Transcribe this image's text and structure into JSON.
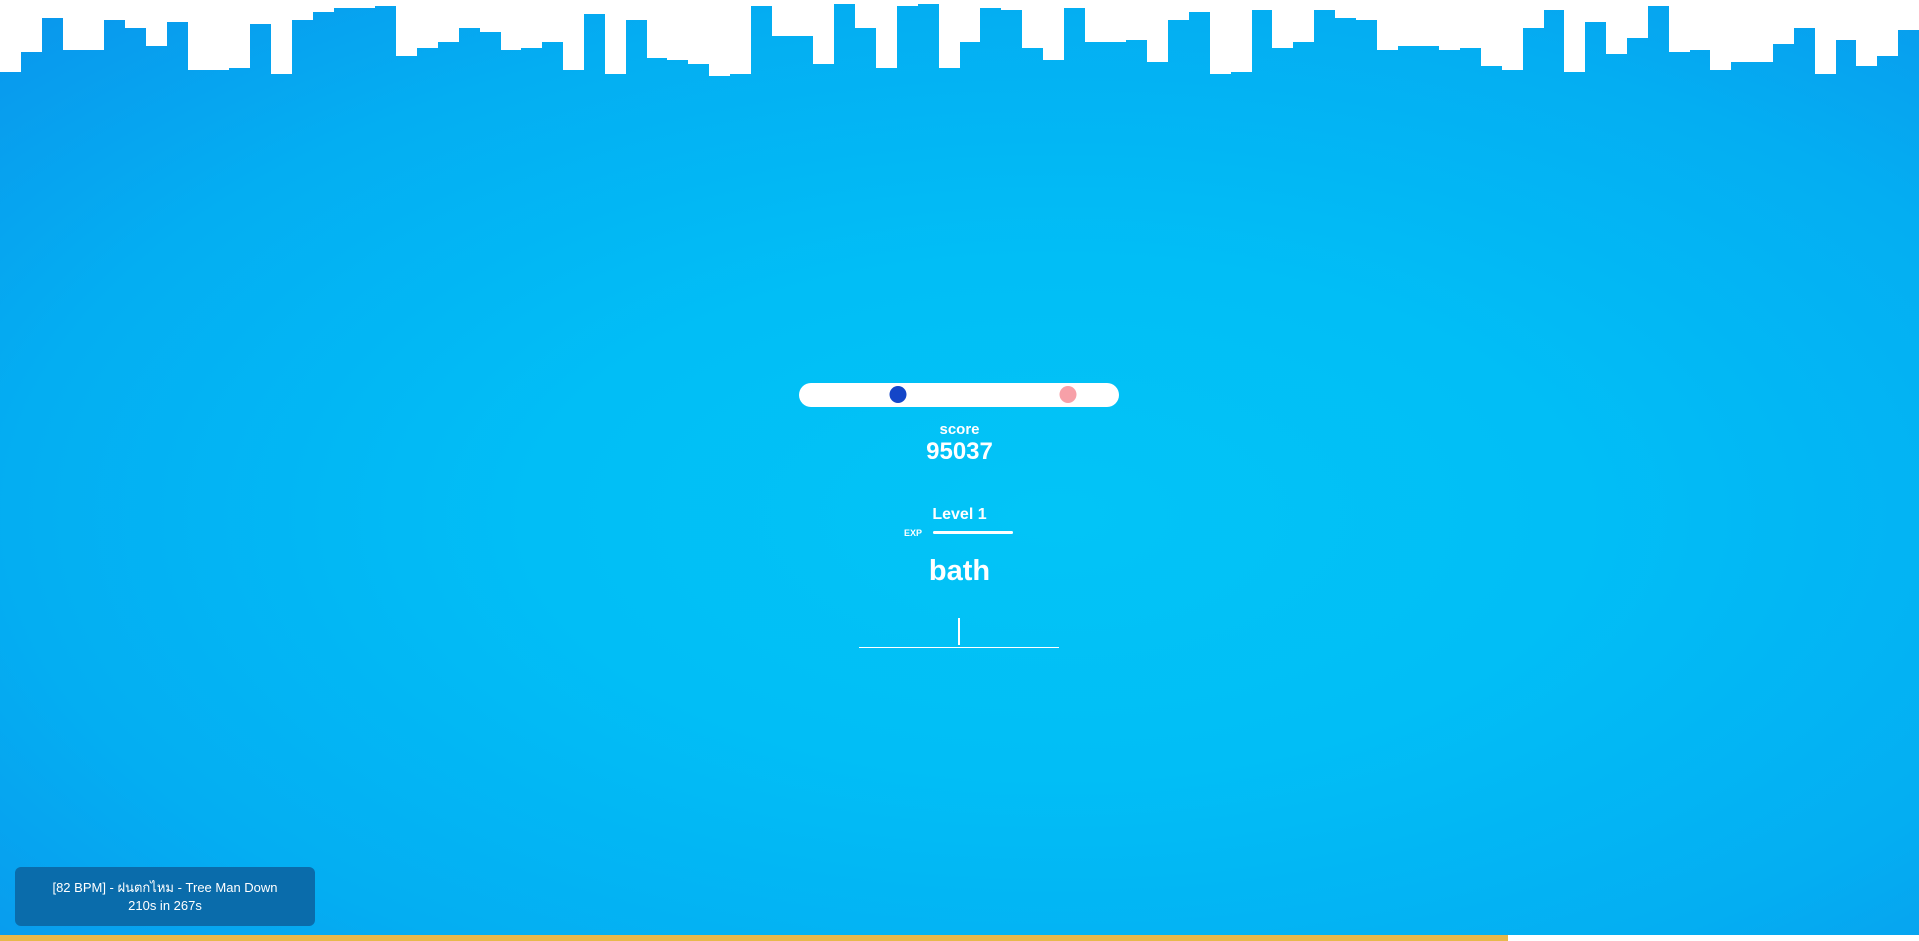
{
  "game": {
    "score_label": "score",
    "score_value": "95037",
    "level_label": "Level 1",
    "exp_label": "EXP",
    "exp_progress": 1.0,
    "current_word": "bath",
    "typed_text": "",
    "beat": {
      "player_position": 0.31,
      "target_position": 0.84
    }
  },
  "song": {
    "title": "[82 BPM] - ฝนตกไหม - Tree Man Down",
    "time": "210s in 267s",
    "progress": 0.786
  },
  "colors": {
    "background": "#02c4f7",
    "player_dot": "#1446c8",
    "target_dot": "#f7a0a8",
    "song_panel": "#0a6cab",
    "progress_fill": "#e8b84a"
  }
}
